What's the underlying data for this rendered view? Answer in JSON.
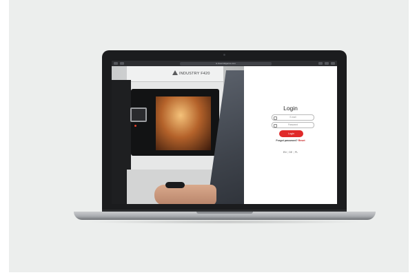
{
  "browser": {
    "url": "● cloud.3dgence.com"
  },
  "hero": {
    "brand_small": "3DGence",
    "brand_name": "INDUSTRY F420"
  },
  "login": {
    "title": "Login",
    "email_placeholder": "E-mail",
    "password_placeholder": "Password",
    "login_button": "Login",
    "forgot_text": "Forgot password?",
    "reset_link": "Reset",
    "languages": [
      "EN",
      "DE",
      "PL"
    ]
  },
  "colors": {
    "accent": "#e02a2a",
    "background": "#eceeed",
    "laptop": "#1b1c1e"
  }
}
